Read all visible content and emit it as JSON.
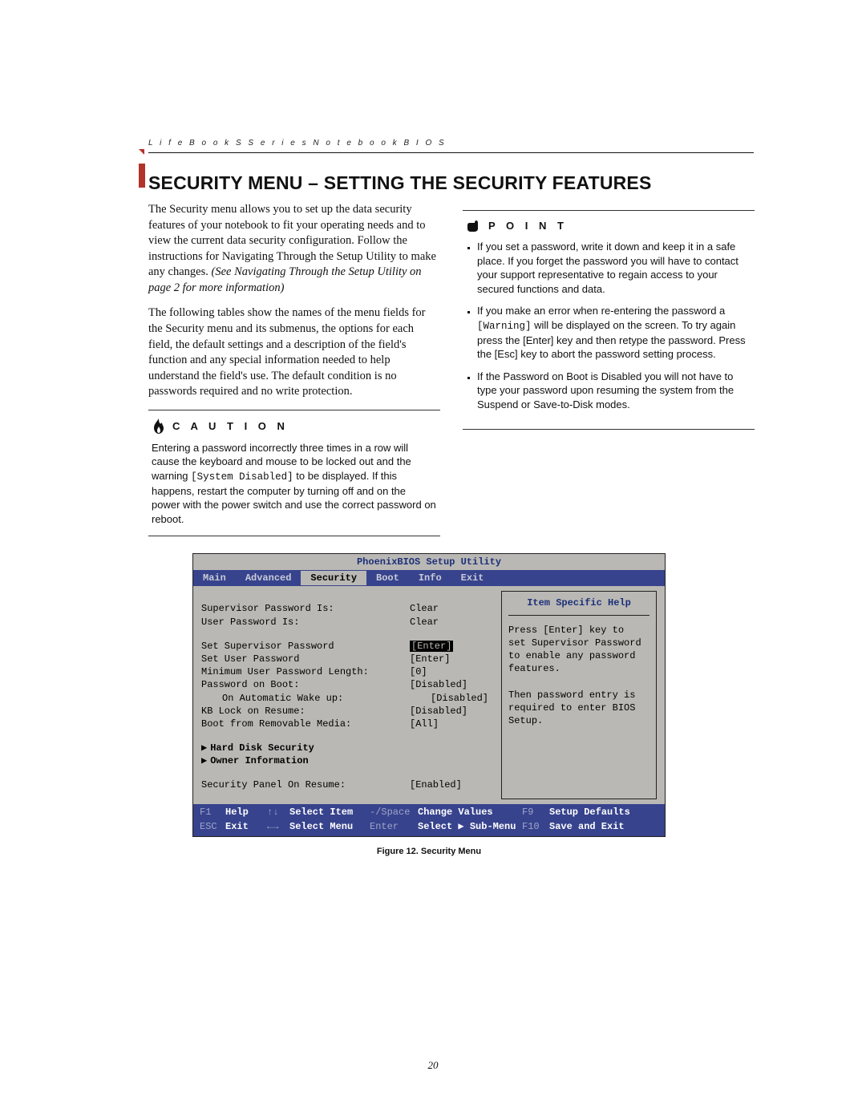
{
  "running_head": "L i f e B o o k   S   S e r i e s   N o t e b o o k   B I O S",
  "section_title": "SECURITY MENU – SETTING THE SECURITY FEATURES",
  "intro_p1a": "The Security menu allows you to set up the data security features of your notebook to fit your operating needs and to view the current data security configuration. Follow the instructions for Navigating Through the Setup Utility to make any changes. ",
  "intro_p1b": "(See Navigating Through the Setup Utility on page 2 for more information)",
  "intro_p2": "The following tables show the names of the menu fields for the Security menu and its submenus, the options for each field, the default settings and a description of the field's function and any special information needed to help understand the field's use. The default condition is no passwords required and no write protection.",
  "caution": {
    "title": "C A U T I O N",
    "text_a": "Entering a password incorrectly three times in a row will cause the keyboard and mouse to be locked out and the warning ",
    "code": "[System Disabled]",
    "text_b": " to be displayed. If this happens, restart the computer by turning off and on the power with the power switch and use the correct password on reboot."
  },
  "point": {
    "title": "P O I N T",
    "items": [
      {
        "text": "If you set a password, write it down and keep it in a safe place. If you forget the password you will have to contact your support representative to regain access to your secured functions and data."
      },
      {
        "text_a": "If you make an error when re-entering the password a ",
        "code": "[Warning]",
        "text_b": " will be displayed on the screen. To try again press the [Enter] key and then retype the password. Press the [Esc] key to abort the password setting process."
      },
      {
        "text": "If the Password on Boot is Disabled you will not have to type your password upon resuming the system from the Suspend or Save-to-Disk modes."
      }
    ]
  },
  "bios": {
    "title": "PhoenixBIOS Setup Utility",
    "tabs": [
      "Main",
      "Advanced",
      "Security",
      "Boot",
      "Info",
      "Exit"
    ],
    "active_tab": "Security",
    "help_title": "Item Specific Help",
    "help_lines": [
      "Press [Enter] key to",
      "set Supervisor Password",
      "to enable any password",
      "features.",
      "",
      "Then password entry is",
      "required to enter BIOS",
      "Setup."
    ],
    "rows": [
      {
        "label": "Supervisor Password Is:",
        "value": "Clear"
      },
      {
        "label": "User Password Is:",
        "value": "Clear"
      },
      {
        "blank": true
      },
      {
        "label": "Set Supervisor Password",
        "value": "[Enter]",
        "hl": true
      },
      {
        "label": "Set User Password",
        "value": "[Enter]"
      },
      {
        "label": "Minimum User Password Length:",
        "value": "[0]"
      },
      {
        "label": "Password on Boot:",
        "value": "[Disabled]"
      },
      {
        "label": "On Automatic Wake up:",
        "value": "[Disabled]",
        "indent": true
      },
      {
        "label": "KB Lock on Resume:",
        "value": "[Disabled]"
      },
      {
        "label": "Boot from Removable Media:",
        "value": "[All]"
      },
      {
        "blank": true
      },
      {
        "label": "Hard Disk Security",
        "submenu": true
      },
      {
        "label": "Owner Information",
        "submenu": true
      },
      {
        "blank": true
      },
      {
        "label": "Security Panel On Resume:",
        "value": "[Enabled]"
      }
    ],
    "footer": {
      "r1": {
        "k1": "F1",
        "v1": "Help",
        "k2": "↑↓",
        "v2": "Select Item",
        "k3": "-/Space",
        "v3": "Change Values",
        "k4": "F9",
        "v4": "Setup Defaults"
      },
      "r2": {
        "k1": "ESC",
        "v1": "Exit",
        "k2": "←→",
        "v2": "Select Menu",
        "k3": "Enter",
        "v3": "Select ▶ Sub-Menu",
        "k4": "F10",
        "v4": "Save and Exit"
      }
    }
  },
  "figure_caption": "Figure 12.  Security Menu",
  "page_number": "20"
}
